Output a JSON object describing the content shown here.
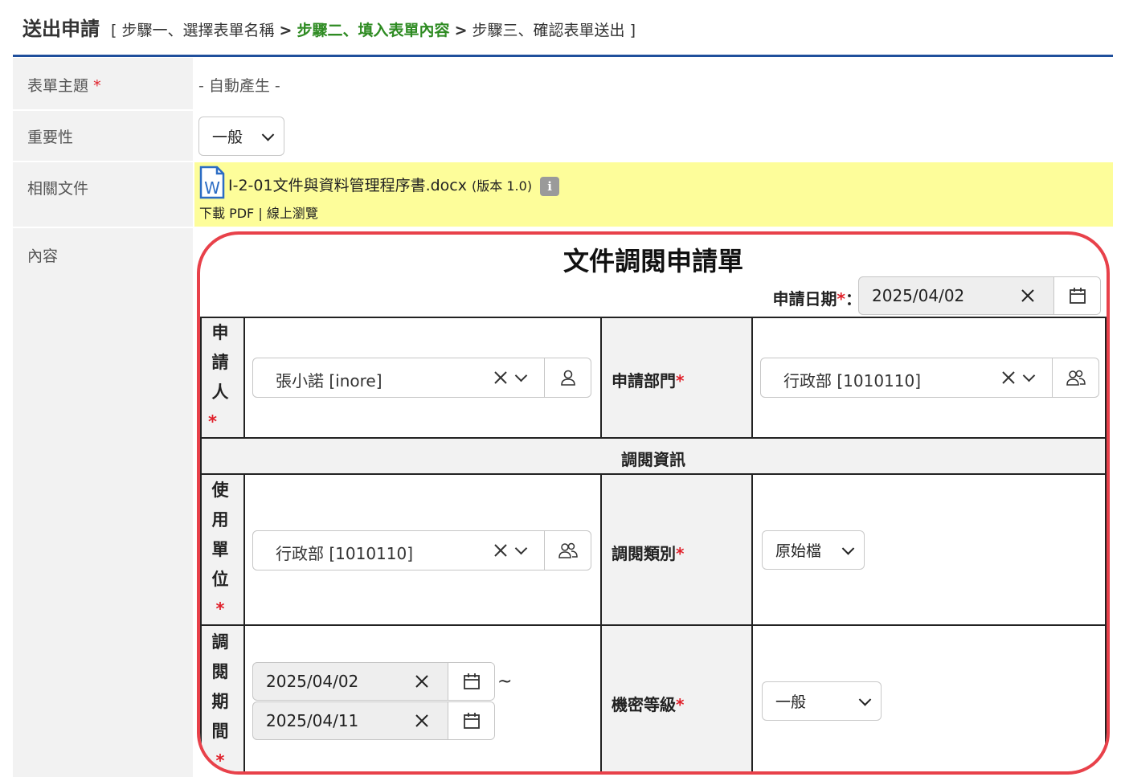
{
  "header": {
    "title": "送出申請",
    "crumb_open": "[",
    "step1": "步驟一、選擇表單名稱",
    "sep1": ">",
    "step2": "步驟二、填入表單內容",
    "sep2": ">",
    "step3": "步驟三、確認表單送出",
    "crumb_close": "]"
  },
  "rows": {
    "subject_label": "表單主題",
    "subject_required": "*",
    "subject_value": "- 自動產生 -",
    "importance_label": "重要性",
    "importance_value": "一般",
    "docs_label": "相關文件",
    "content_label": "內容"
  },
  "document": {
    "file_name": "I-2-01文件與資料管理程序書.docx",
    "version": "(版本 1.0)",
    "info_icon": "i",
    "links": "下載 PDF | 線上瀏覽",
    "icon": "word-doc-icon"
  },
  "form": {
    "title": "文件調閱申請單",
    "apply_date_label": "申請日期",
    "apply_date_suffix": "：",
    "apply_date_value": "2025/04/02",
    "required_mark": "*",
    "applicant_label": [
      "申",
      "請",
      "人"
    ],
    "applicant_value": "張小諾 [inore]",
    "dept_label": "申請部門",
    "dept_value": "行政部 [1010110]",
    "section_title": "調閱資訊",
    "unit_label": [
      "使",
      "用",
      "單",
      "位"
    ],
    "unit_value": "行政部 [1010110]",
    "type_label": "調閱類別",
    "type_value": "原始檔",
    "period_label": [
      "調",
      "閱",
      "期",
      "間"
    ],
    "period_start": "2025/04/02",
    "period_end": "2025/04/11",
    "period_tilde": "~",
    "secret_label": "機密等級",
    "secret_value": "一般"
  },
  "colors": {
    "accent_blue": "#1f4f9c",
    "active_step_green": "#2e8b22",
    "required_red": "#e0202a",
    "highlight_frame_red": "#e8414a",
    "doc_row_yellow": "#fdfd9a"
  }
}
